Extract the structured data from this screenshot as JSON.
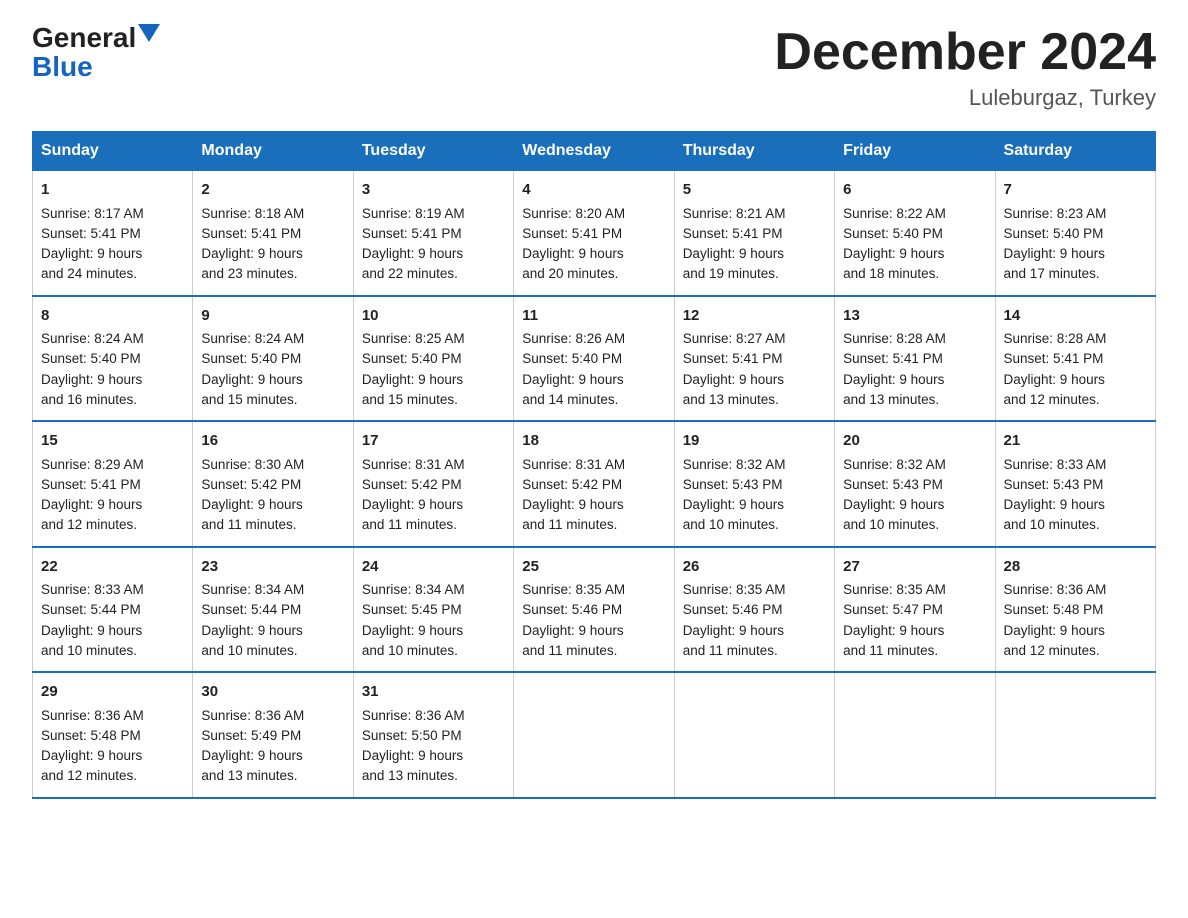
{
  "header": {
    "logo_general": "General",
    "logo_blue": "Blue",
    "month_title": "December 2024",
    "location": "Luleburgaz, Turkey"
  },
  "days_of_week": [
    "Sunday",
    "Monday",
    "Tuesday",
    "Wednesday",
    "Thursday",
    "Friday",
    "Saturday"
  ],
  "weeks": [
    [
      {
        "day": "1",
        "sunrise": "8:17 AM",
        "sunset": "5:41 PM",
        "daylight": "9 hours and 24 minutes."
      },
      {
        "day": "2",
        "sunrise": "8:18 AM",
        "sunset": "5:41 PM",
        "daylight": "9 hours and 23 minutes."
      },
      {
        "day": "3",
        "sunrise": "8:19 AM",
        "sunset": "5:41 PM",
        "daylight": "9 hours and 22 minutes."
      },
      {
        "day": "4",
        "sunrise": "8:20 AM",
        "sunset": "5:41 PM",
        "daylight": "9 hours and 20 minutes."
      },
      {
        "day": "5",
        "sunrise": "8:21 AM",
        "sunset": "5:41 PM",
        "daylight": "9 hours and 19 minutes."
      },
      {
        "day": "6",
        "sunrise": "8:22 AM",
        "sunset": "5:40 PM",
        "daylight": "9 hours and 18 minutes."
      },
      {
        "day": "7",
        "sunrise": "8:23 AM",
        "sunset": "5:40 PM",
        "daylight": "9 hours and 17 minutes."
      }
    ],
    [
      {
        "day": "8",
        "sunrise": "8:24 AM",
        "sunset": "5:40 PM",
        "daylight": "9 hours and 16 minutes."
      },
      {
        "day": "9",
        "sunrise": "8:24 AM",
        "sunset": "5:40 PM",
        "daylight": "9 hours and 15 minutes."
      },
      {
        "day": "10",
        "sunrise": "8:25 AM",
        "sunset": "5:40 PM",
        "daylight": "9 hours and 15 minutes."
      },
      {
        "day": "11",
        "sunrise": "8:26 AM",
        "sunset": "5:40 PM",
        "daylight": "9 hours and 14 minutes."
      },
      {
        "day": "12",
        "sunrise": "8:27 AM",
        "sunset": "5:41 PM",
        "daylight": "9 hours and 13 minutes."
      },
      {
        "day": "13",
        "sunrise": "8:28 AM",
        "sunset": "5:41 PM",
        "daylight": "9 hours and 13 minutes."
      },
      {
        "day": "14",
        "sunrise": "8:28 AM",
        "sunset": "5:41 PM",
        "daylight": "9 hours and 12 minutes."
      }
    ],
    [
      {
        "day": "15",
        "sunrise": "8:29 AM",
        "sunset": "5:41 PM",
        "daylight": "9 hours and 12 minutes."
      },
      {
        "day": "16",
        "sunrise": "8:30 AM",
        "sunset": "5:42 PM",
        "daylight": "9 hours and 11 minutes."
      },
      {
        "day": "17",
        "sunrise": "8:31 AM",
        "sunset": "5:42 PM",
        "daylight": "9 hours and 11 minutes."
      },
      {
        "day": "18",
        "sunrise": "8:31 AM",
        "sunset": "5:42 PM",
        "daylight": "9 hours and 11 minutes."
      },
      {
        "day": "19",
        "sunrise": "8:32 AM",
        "sunset": "5:43 PM",
        "daylight": "9 hours and 10 minutes."
      },
      {
        "day": "20",
        "sunrise": "8:32 AM",
        "sunset": "5:43 PM",
        "daylight": "9 hours and 10 minutes."
      },
      {
        "day": "21",
        "sunrise": "8:33 AM",
        "sunset": "5:43 PM",
        "daylight": "9 hours and 10 minutes."
      }
    ],
    [
      {
        "day": "22",
        "sunrise": "8:33 AM",
        "sunset": "5:44 PM",
        "daylight": "9 hours and 10 minutes."
      },
      {
        "day": "23",
        "sunrise": "8:34 AM",
        "sunset": "5:44 PM",
        "daylight": "9 hours and 10 minutes."
      },
      {
        "day": "24",
        "sunrise": "8:34 AM",
        "sunset": "5:45 PM",
        "daylight": "9 hours and 10 minutes."
      },
      {
        "day": "25",
        "sunrise": "8:35 AM",
        "sunset": "5:46 PM",
        "daylight": "9 hours and 11 minutes."
      },
      {
        "day": "26",
        "sunrise": "8:35 AM",
        "sunset": "5:46 PM",
        "daylight": "9 hours and 11 minutes."
      },
      {
        "day": "27",
        "sunrise": "8:35 AM",
        "sunset": "5:47 PM",
        "daylight": "9 hours and 11 minutes."
      },
      {
        "day": "28",
        "sunrise": "8:36 AM",
        "sunset": "5:48 PM",
        "daylight": "9 hours and 12 minutes."
      }
    ],
    [
      {
        "day": "29",
        "sunrise": "8:36 AM",
        "sunset": "5:48 PM",
        "daylight": "9 hours and 12 minutes."
      },
      {
        "day": "30",
        "sunrise": "8:36 AM",
        "sunset": "5:49 PM",
        "daylight": "9 hours and 13 minutes."
      },
      {
        "day": "31",
        "sunrise": "8:36 AM",
        "sunset": "5:50 PM",
        "daylight": "9 hours and 13 minutes."
      },
      null,
      null,
      null,
      null
    ]
  ],
  "labels": {
    "sunrise": "Sunrise:",
    "sunset": "Sunset:",
    "daylight": "Daylight:"
  }
}
